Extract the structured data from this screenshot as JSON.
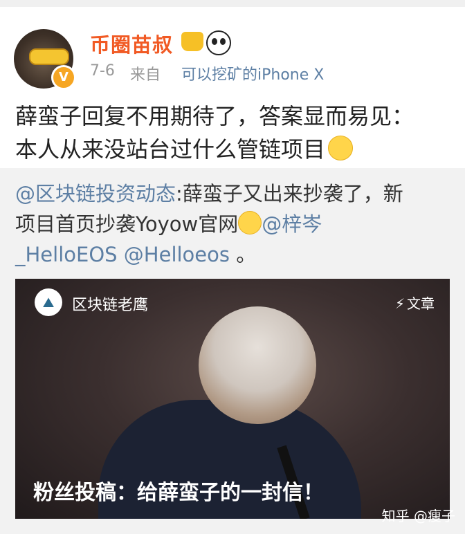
{
  "post": {
    "author": "币圈苗叔",
    "date": "7-6",
    "from_prefix": "来自",
    "device": "可以挖矿的iPhone X",
    "text_line1": "薛蛮子回复不用期待了，答案显而易见：",
    "text_line2": "本人从来没站台过什么管链项目"
  },
  "repost": {
    "mention": "@区块链投资动态",
    "text_part1": ":薛蛮子又出来抄袭了，新",
    "text_part2": "项目首页抄袭Yoyow官网",
    "mention2": "@梓岑",
    "mention3": "_HelloEOS",
    "mention4": "@Helloeos",
    "end_mark": "。"
  },
  "video": {
    "channel": "区块链老鹰",
    "tag": "文章",
    "banner": "粉丝投稿：给薛蛮子的一封信！"
  },
  "watermark": "知乎 @瘦子",
  "icons": {
    "crown": "crown-icon",
    "panda": "panda-icon",
    "smile": "smile-icon",
    "sweat": "sweat-icon",
    "verified": "verified-badge",
    "bolt": "bolt-icon"
  },
  "colors": {
    "author": "#f15a24",
    "link": "#5d7fa4",
    "meta": "#999999",
    "repost_bg": "#f2f2f2"
  }
}
